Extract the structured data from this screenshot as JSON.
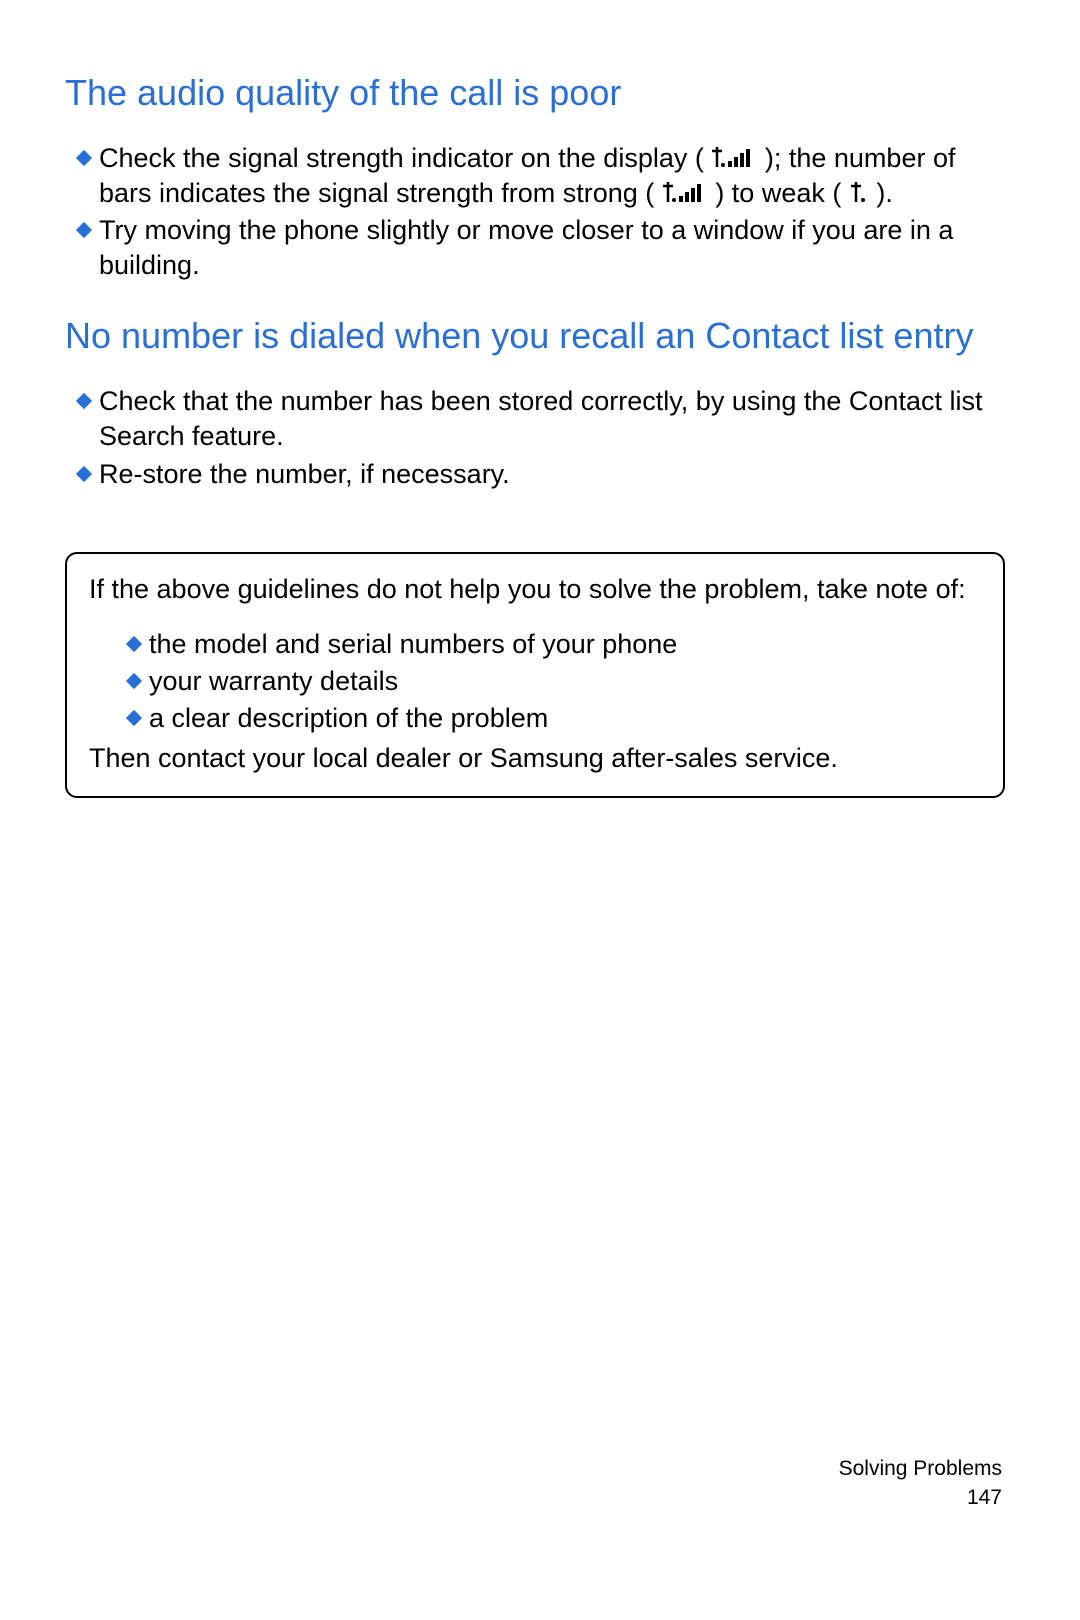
{
  "section1": {
    "heading": "The audio quality of the call is poor",
    "b1a": "Check the signal strength indicator on the display (",
    "b1b": "); the number of bars indicates the signal strength from strong (",
    "b1c": ") to weak (",
    "b1d": ").",
    "b2": "Try moving the phone slightly or move closer to a window if you are in a building."
  },
  "section2": {
    "heading": "No number is dialed when you recall an Contact list entry",
    "b1": "Check that the number has been stored correctly, by using the Contact list Search feature.",
    "b2": "Re-store the number, if necessary."
  },
  "note": {
    "intro": "If the above guidelines do not help you to solve the problem, take note of:",
    "i1": "the model and serial numbers of your phone",
    "i2": "your warranty details",
    "i3": "a clear description of the problem",
    "outro": "Then contact your local dealer or Samsung after-sales service."
  },
  "footer": {
    "chapter": "Solving Problems",
    "page": "147"
  },
  "icons": {
    "diamond": "diamond-bullet-icon",
    "signal_full": "signal-full-icon",
    "signal_weak": "signal-weak-icon"
  }
}
